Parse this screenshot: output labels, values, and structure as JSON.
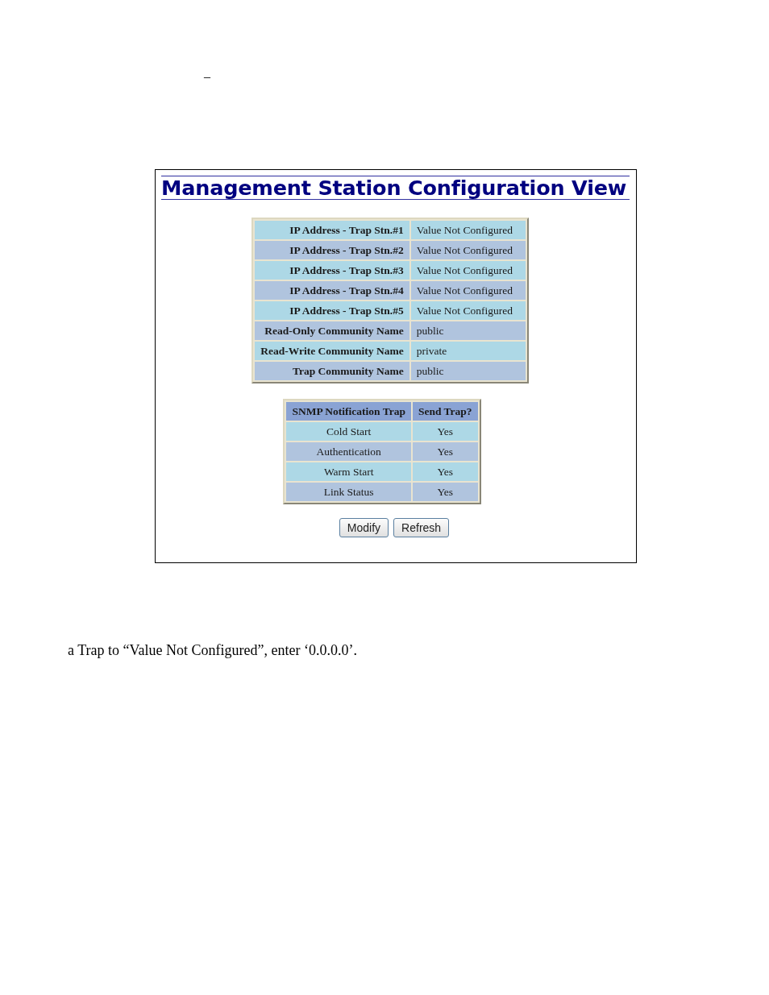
{
  "stray_mark": "_",
  "screen": {
    "title": "Management Station Configuration View",
    "settings_table": {
      "rows": [
        {
          "label": "IP Address - Trap Stn.#1",
          "value": "Value Not Configured"
        },
        {
          "label": "IP Address - Trap Stn.#2",
          "value": "Value Not Configured"
        },
        {
          "label": "IP Address - Trap Stn.#3",
          "value": "Value Not Configured"
        },
        {
          "label": "IP Address - Trap Stn.#4",
          "value": "Value Not Configured"
        },
        {
          "label": "IP Address - Trap Stn.#5",
          "value": "Value Not Configured"
        },
        {
          "label": "Read-Only Community Name",
          "value": "public"
        },
        {
          "label": "Read-Write Community Name",
          "value": "private"
        },
        {
          "label": "Trap Community Name",
          "value": "public"
        }
      ]
    },
    "trap_table": {
      "columns": [
        "SNMP Notification Trap",
        "Send Trap?"
      ],
      "rows": [
        {
          "trap": "Cold Start",
          "send": "Yes"
        },
        {
          "trap": "Authentication",
          "send": "Yes"
        },
        {
          "trap": "Warm Start",
          "send": "Yes"
        },
        {
          "trap": "Link Status",
          "send": "Yes"
        }
      ]
    },
    "buttons": [
      "Modify",
      "Refresh"
    ]
  },
  "body_text": "a Trap to “Value Not Configured”, enter ‘0.0.0.0’."
}
